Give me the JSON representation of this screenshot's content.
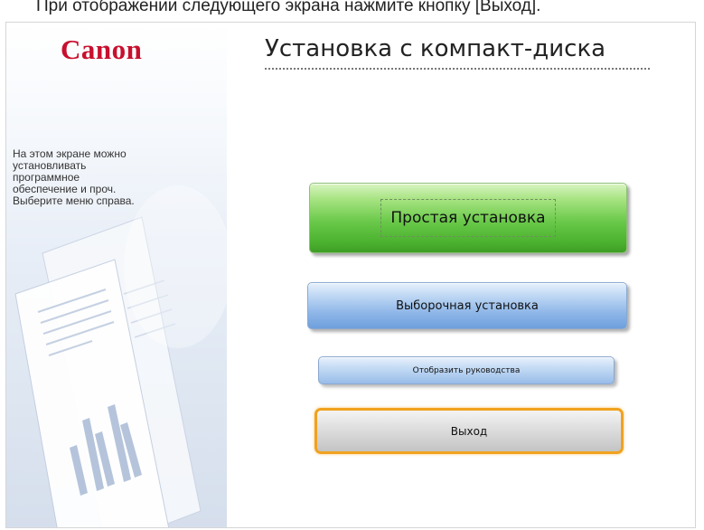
{
  "instruction": "При отображении следующего экрана нажмите кнопку [Выход].",
  "logo": "Canon",
  "title": "Установка с компакт-диска",
  "sidebar": {
    "text_lines": [
      "На этом экране можно",
      "установливать",
      "программное",
      "обеспечение и проч.",
      "Выберите меню справа."
    ]
  },
  "buttons": {
    "easy_install": "Простая установка",
    "custom_install": "Выборочная установка",
    "display_manuals": "Отобразить руководства",
    "exit": "Выход"
  },
  "colors": {
    "brand": "#c8102e",
    "green_button": "#5bbf3a",
    "blue_button": "#8fb7e8",
    "exit_focus_border": "#f0a21e"
  }
}
